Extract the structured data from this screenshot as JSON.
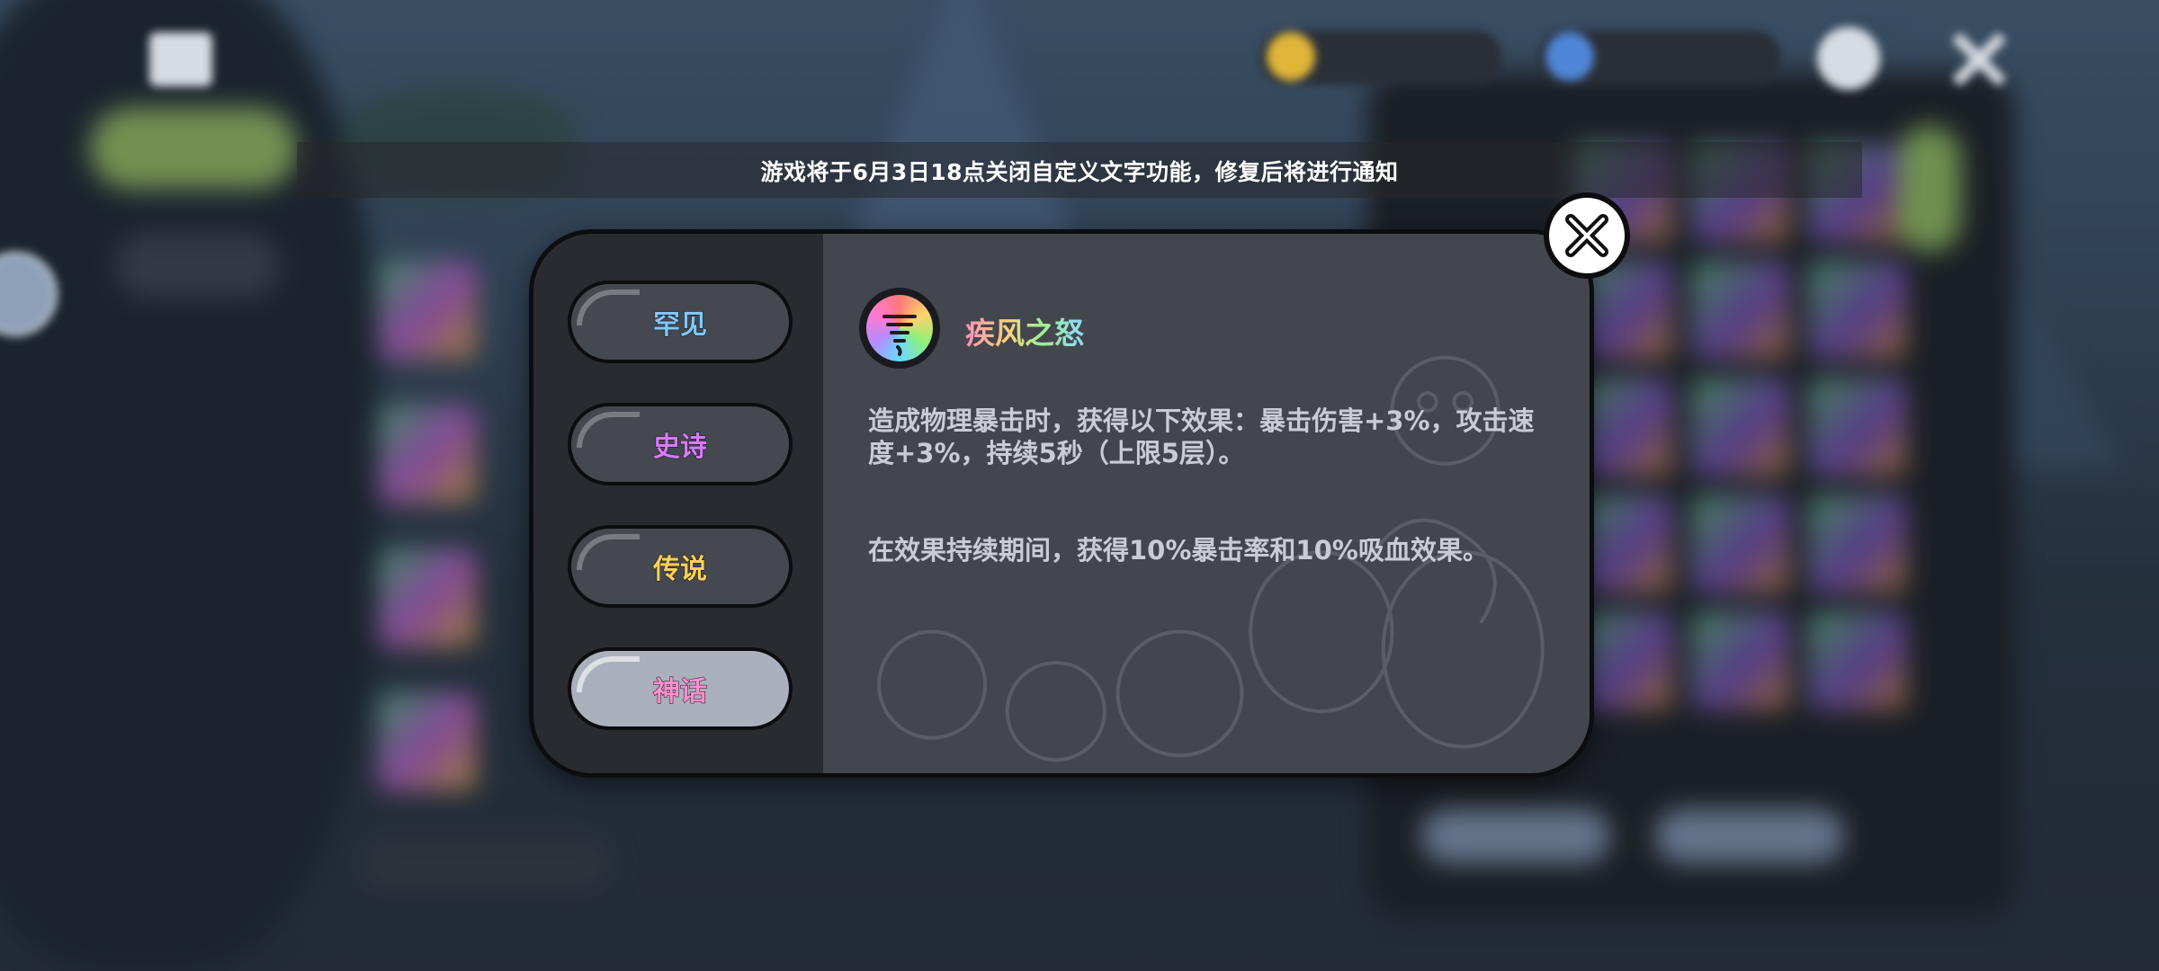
{
  "notice": {
    "text": "游戏将于6月3日18点关闭自定义文字功能，修复后将进行通知"
  },
  "rarity_tabs": [
    {
      "label": "罕见",
      "color": "#7ec8ff",
      "active": false
    },
    {
      "label": "史诗",
      "color": "#d77bff",
      "active": false
    },
    {
      "label": "传说",
      "color": "#ffd25a",
      "active": false
    },
    {
      "label": "神话",
      "color": "#ff8fd0",
      "active": true
    }
  ],
  "skill": {
    "name": "疾风之怒",
    "icon": "tornado-icon",
    "description_1": "造成物理暴击时，获得以下效果：暴击伤害+3%，攻击速度+3%，持续5秒（上限5层）。",
    "description_2": "在效果持续期间，获得10%暴击率和10%吸血效果。"
  },
  "close_icon": "close-icon",
  "colors": {
    "modal_border": "#0d0d10",
    "sidebar_bg": "#2a2b31",
    "content_bg": "#44464e",
    "active_tab_bg": "#aab1bd"
  }
}
